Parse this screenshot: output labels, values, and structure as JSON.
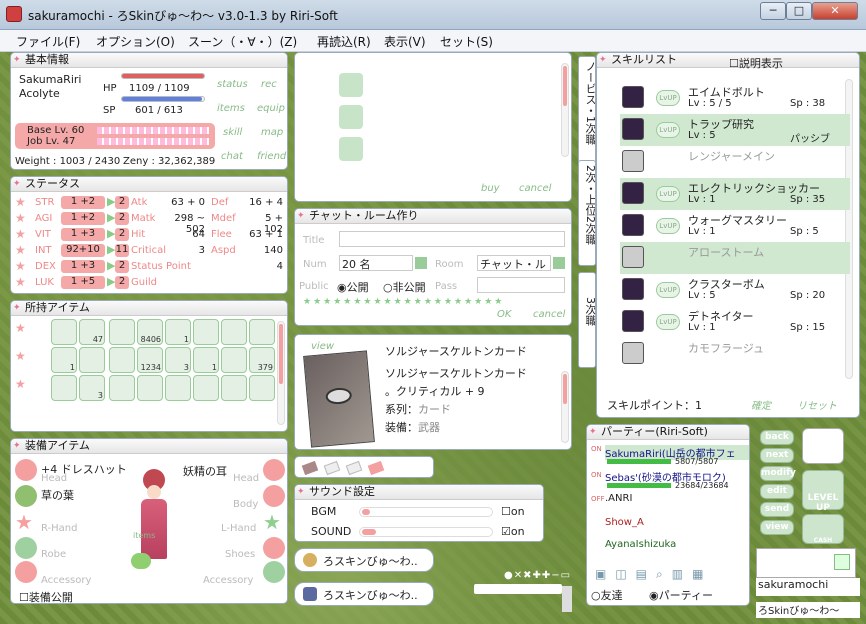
{
  "window": {
    "title": "sakuramochi - ろSkinびゅ～わ～ v3.0-1.3 by Riri-Soft",
    "min": "─",
    "max": "□",
    "close": "✕"
  },
  "menu": [
    "ファイル(F)",
    "オプション(O)",
    "スーン（・∀・）(Z)",
    "再読込(R)",
    "表示(V)",
    "セット(S)"
  ],
  "basic": {
    "header": "基本情報",
    "name": "SakumaRiri",
    "job": "Acolyte",
    "hp_label": "HP",
    "hp": "1109  /  1109",
    "sp_label": "SP",
    "sp": "601  /  613",
    "base": "Base Lv. 60",
    "jobl": "Job Lv. 47",
    "weight": "Weight : 1003 / 2430",
    "zeny": "Zeny : 32,362,389",
    "btns": [
      "status",
      "rec",
      "items",
      "equip",
      "skill",
      "map",
      "chat",
      "friend"
    ],
    "hp_fill": 1.0,
    "sp_fill": 0.98
  },
  "status": {
    "header": "ステータス",
    "rows": [
      {
        "k": "STR",
        "v": "1  +2",
        "p": "2",
        "k2": "Atk",
        "v2": "63 + 0",
        "k3": "Def",
        "v3": "16 + 4"
      },
      {
        "k": "AGI",
        "v": "1  +2",
        "p": "2",
        "k2": "Matk",
        "v2": "298 ~ 502",
        "k3": "Mdef",
        "v3": "5 + 102"
      },
      {
        "k": "VIT",
        "v": "1  +3",
        "p": "2",
        "k2": "Hit",
        "v2": "64",
        "k3": "Flee",
        "v3": "63 + 1"
      },
      {
        "k": "INT",
        "v": "92+10",
        "p": "11",
        "k2": "Critical",
        "v2": "3",
        "k3": "Aspd",
        "v3": "140"
      },
      {
        "k": "DEX",
        "v": "1  +3",
        "p": "2",
        "k2": "Status Point",
        "v2": "",
        "k3": "",
        "v3": "4"
      },
      {
        "k": "LUK",
        "v": "1  +5",
        "p": "2",
        "k2": "Guild",
        "v2": "",
        "k3": "",
        "v3": ""
      }
    ]
  },
  "items": {
    "header": "所持アイテム",
    "counts": [
      "",
      "47",
      "",
      "8406",
      "1",
      "",
      "",
      "",
      "1",
      "",
      "",
      "1234",
      "3",
      "1",
      "",
      "379",
      "",
      "3",
      "",
      "",
      "",
      "",
      ""
    ]
  },
  "equip": {
    "header": "装備アイテム",
    "head_l": "+4 ドレスハット",
    "head_r": "妖精の耳",
    "body": "草の葉",
    "labels": [
      "Head",
      "Head",
      "Body",
      "R-Hand",
      "L-Hand",
      "Robe",
      "Shoes",
      "Accessory",
      "Accessory"
    ],
    "public": "装備公開",
    "pet": "items"
  },
  "shop": {
    "btns": [
      "buy",
      "cancel"
    ]
  },
  "chat": {
    "header": "チャット・ルーム作り",
    "title_lbl": "Title",
    "num_lbl": "Num",
    "num": "20 名",
    "room_lbl": "Room",
    "room": "チャット・ルー",
    "public_lbl": "Public",
    "pub": "公開",
    "priv": "非公開",
    "pass_lbl": "Pass",
    "ok": "OK",
    "cancel": "cancel"
  },
  "card": {
    "view": "view",
    "title": "ソルジャースケルトンカード",
    "line1": "ソルジャースケルトンカード",
    "line2": "。クリティカル + 9",
    "line3a": "系列：",
    "line3b": "カード",
    "line4a": "装備：",
    "line4b": "武器"
  },
  "sound": {
    "header": "サウンド設定",
    "bgm": "BGM",
    "sound": "SOUND",
    "on": "on"
  },
  "taskbtns": [
    "ろスキンびゅ～わ..",
    "ろスキンびゅ～わ.."
  ],
  "jobtabs": {
    "a": "ノービス・1次職",
    "b": "2次・上位2次職",
    "c": "3次職"
  },
  "skills": {
    "header": "スキルリスト",
    "desc": "説明表示",
    "points": "スキルポイント：1",
    "confirm": "確定",
    "reset": "リセット",
    "list": [
      {
        "n": "エイムドボルト",
        "lv": "Lv :  5  /  5",
        "sp": "Sp : 38",
        "hl": false,
        "dim": false
      },
      {
        "n": "トラップ研究",
        "lv": "Lv : 5",
        "sp": "パッシブ",
        "hl": true,
        "dim": false
      },
      {
        "n": "レンジャーメイン",
        "lv": "",
        "sp": "",
        "hl": false,
        "dim": true
      },
      {
        "n": "エレクトリックショッカー",
        "lv": "Lv : 1",
        "sp": "Sp : 35",
        "hl": true,
        "dim": false
      },
      {
        "n": "ウォーグマスタリー",
        "lv": "Lv : 1",
        "sp": "Sp : 5",
        "hl": false,
        "dim": false
      },
      {
        "n": "アローストーム",
        "lv": "",
        "sp": "",
        "hl": true,
        "dim": true
      },
      {
        "n": "クラスターボム",
        "lv": "Lv : 5",
        "sp": "Sp : 20",
        "hl": false,
        "dim": false
      },
      {
        "n": "デトネイター",
        "lv": "Lv : 1",
        "sp": "Sp : 15",
        "hl": false,
        "dim": false
      },
      {
        "n": "カモフラージュ",
        "lv": "",
        "sp": "",
        "hl": false,
        "dim": true
      }
    ]
  },
  "party": {
    "header": "パーティー(Riri-Soft)",
    "m1": "SakumaRiri(山岳の都市フェ",
    "m1hp": "5807/5807",
    "m2": "Sebas'(砂漠の都市モロク)",
    "m2hp": "23684/23684",
    "m3": ".ANRI",
    "m4": "Show_A",
    "m5": "AyanaIshizuka",
    "off": "OFF",
    "on": "ON",
    "friend": "友達",
    "party": "パーティー"
  },
  "rightbtns": [
    "back",
    "next",
    "modify",
    "edit",
    "send",
    "view"
  ],
  "levelup": "LEVEL UP",
  "cash": "CASH",
  "charname": "sakuramochi",
  "skinname": "ろSkinびゅ～わ～"
}
